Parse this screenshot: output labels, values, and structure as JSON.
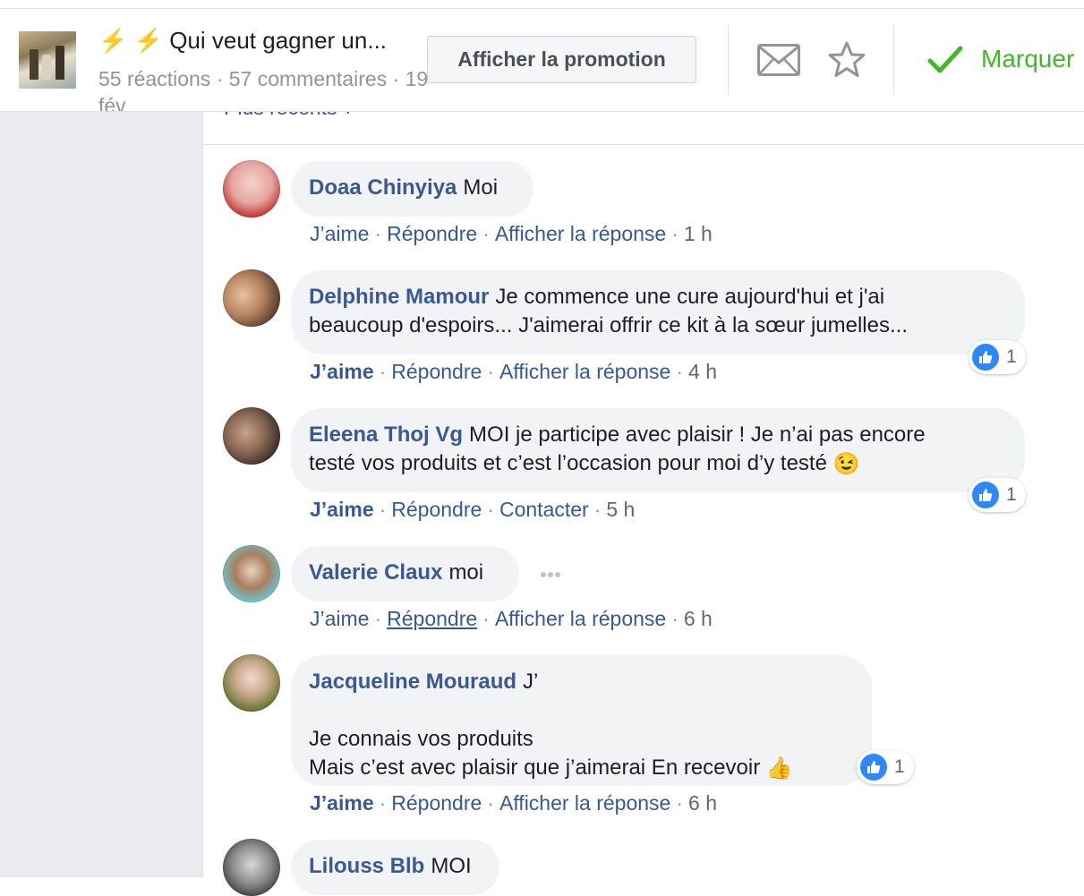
{
  "header": {
    "title": "⚡ ⚡ Qui veut gagner un...",
    "meta": "55 réactions · 57 commentaires · 19 fév",
    "promotion_button": "Afficher la promotion",
    "mark_button": "Marquer",
    "icons": [
      "envelope-icon",
      "star-icon",
      "checkmark-icon"
    ],
    "mark_color": "#42b72a"
  },
  "sort": {
    "label": "Plus récents ▾"
  },
  "colors": {
    "name": "#385898",
    "link": "#365899",
    "bubble": "#f2f3f5",
    "like": "#2d88ff"
  },
  "comments": [
    {
      "author": "Doaa Chinyiya",
      "text": "Moi",
      "actions": {
        "like": "J’aime",
        "reply": "Répondre",
        "third": "Afficher la réponse",
        "time": "1 h"
      },
      "liked": false
    },
    {
      "author": "Delphine Mamour",
      "text": "Je commence une cure aujourd'hui et j'ai\nbeaucoup d'espoirs... J'aimerai offrir ce kit à la sœur jumelles...",
      "actions": {
        "like": "J’aime",
        "reply": "Répondre",
        "third": "Afficher la réponse",
        "time": "4 h"
      },
      "liked": true,
      "reactions": "1"
    },
    {
      "author": "Eleena Thoj Vg",
      "text": "MOI je participe avec plaisir ! Je n’ai pas encore\ntesté vos produits et c’est l’occasion pour moi d’y testé",
      "emoji": "😉",
      "actions": {
        "like": "J’aime",
        "reply": "Répondre",
        "third": "Contacter",
        "time": "5 h"
      },
      "liked": true,
      "reactions": "1"
    },
    {
      "author": "Valerie Claux",
      "text": "moi",
      "actions": {
        "like": "J’aime",
        "reply": "Répondre",
        "third": "Afficher la réponse",
        "time": "6 h"
      },
      "liked": false
    },
    {
      "author": "Jacqueline Mouraud",
      "text": "J’\n\nJe connais vos produits\nMais c’est avec plaisir que j’aimerai En recevoir",
      "emoji": "👍",
      "actions": {
        "like": "J’aime",
        "reply": "Répondre",
        "third": "Afficher la réponse",
        "time": "6 h"
      },
      "liked": true,
      "reactions": "1"
    },
    {
      "author": "Lilouss Blb",
      "text": "MOI"
    }
  ]
}
